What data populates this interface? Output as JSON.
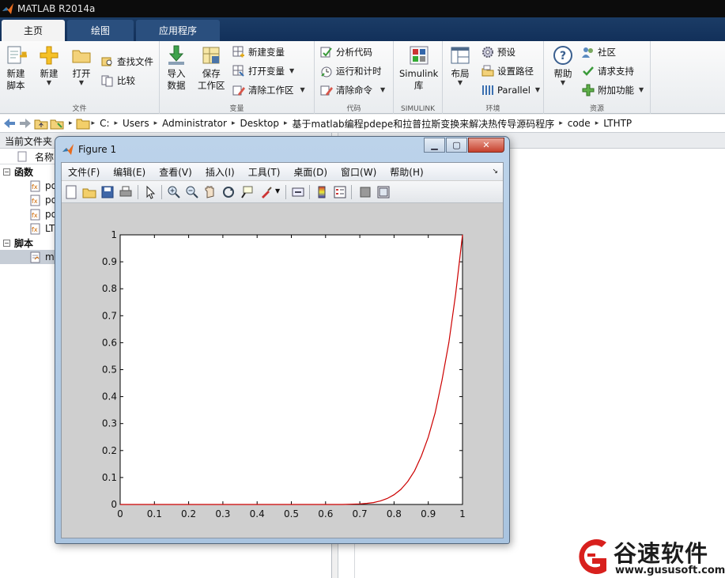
{
  "app": {
    "window_title": "MATLAB R2014a"
  },
  "tabs": [
    {
      "label": "主页",
      "active": true
    },
    {
      "label": "绘图",
      "active": false
    },
    {
      "label": "应用程序",
      "active": false
    }
  ],
  "ribbon": {
    "file_group": {
      "label": "文件",
      "new_script": "新建\n脚本",
      "new": "新建",
      "open": "打开",
      "find_files": "查找文件",
      "compare": "比较"
    },
    "variable_group": {
      "label": "变量",
      "import_data": "导入\n数据",
      "save_workspace": "保存\n工作区",
      "new_variable": "新建变量",
      "open_variable": "打开变量",
      "clear_workspace": "清除工作区"
    },
    "code_group": {
      "label": "代码",
      "analyze_code": "分析代码",
      "run_and_time": "运行和计时",
      "clear_commands": "清除命令"
    },
    "simulink_group": {
      "label": "SIMULINK",
      "simulink_library": "Simulink\n库"
    },
    "environment_group": {
      "label": "环境",
      "layout": "布局",
      "preferences": "预设",
      "set_path": "设置路径",
      "parallel": "Parallel"
    },
    "resources_group": {
      "label": "资源",
      "help": "帮助",
      "community": "社区",
      "request_support": "请求支持",
      "add_ons": "附加功能"
    }
  },
  "address_bar": {
    "crumbs": [
      "C:",
      "Users",
      "Administrator",
      "Desktop",
      "基于matlab编程pdepe和拉普拉斯变换来解决热传导源码程序",
      "code",
      "LTHTP"
    ]
  },
  "current_folder": {
    "title": "当前文件夹",
    "column_name": "名称",
    "sections": [
      {
        "label": "函数",
        "items": [
          "pd",
          "pd",
          "pd",
          "LT"
        ]
      },
      {
        "label": "脚本",
        "items": [
          "m"
        ]
      }
    ]
  },
  "figure": {
    "title": "Figure 1",
    "menu": [
      "文件(F)",
      "编辑(E)",
      "查看(V)",
      "插入(I)",
      "工具(T)",
      "桌面(D)",
      "窗口(W)",
      "帮助(H)"
    ],
    "toolbar_icons": [
      "new-figure-icon",
      "open-file-icon",
      "save-icon",
      "print-icon",
      "pointer-icon",
      "zoom-in-icon",
      "zoom-out-icon",
      "pan-icon",
      "rotate-3d-icon",
      "data-cursor-icon",
      "brush-icon",
      "link-plot-icon",
      "colorbar-icon",
      "legend-icon",
      "hide-plot-tools-icon",
      "show-plot-tools-icon"
    ]
  },
  "chart_data": {
    "type": "line",
    "x_ticks": [
      "0",
      "0.1",
      "0.2",
      "0.3",
      "0.4",
      "0.5",
      "0.6",
      "0.7",
      "0.8",
      "0.9",
      "1"
    ],
    "y_ticks": [
      "0",
      "0.1",
      "0.2",
      "0.3",
      "0.4",
      "0.5",
      "0.6",
      "0.7",
      "0.8",
      "0.9",
      "1"
    ],
    "xlim": [
      0,
      1
    ],
    "ylim": [
      0,
      1
    ],
    "grid": false,
    "series": [
      {
        "color": "#cc0000",
        "x": [
          0,
          0.1,
          0.2,
          0.3,
          0.4,
          0.5,
          0.6,
          0.65,
          0.7,
          0.72,
          0.74,
          0.76,
          0.78,
          0.8,
          0.82,
          0.84,
          0.86,
          0.88,
          0.9,
          0.92,
          0.94,
          0.96,
          0.98,
          1
        ],
        "y": [
          0,
          0,
          0,
          0,
          0,
          0,
          0,
          0,
          0.002,
          0.004,
          0.007,
          0.013,
          0.022,
          0.036,
          0.056,
          0.085,
          0.125,
          0.18,
          0.25,
          0.34,
          0.46,
          0.6,
          0.78,
          1
        ]
      }
    ]
  },
  "watermark": {
    "name": "谷速软件",
    "url": "www.gususoft.com",
    "color": "#d8201d"
  }
}
